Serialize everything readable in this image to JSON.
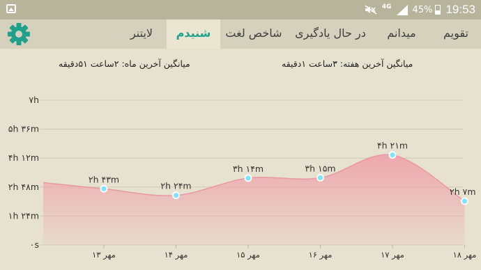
{
  "status_bar": {
    "network": "4G",
    "battery": "45%",
    "battery_level": 0.45,
    "time": "19:53"
  },
  "tabs": [
    {
      "label": "تقویم",
      "active": false
    },
    {
      "label": "میدانم",
      "active": false
    },
    {
      "label": "در حال یادگیری",
      "active": false
    },
    {
      "label": "شاخص لغت",
      "active": false
    },
    {
      "label": "شنیدم",
      "active": true
    },
    {
      "label": "لایتنر",
      "active": false
    }
  ],
  "averages": {
    "week": "میانگین آخرین هفته: ۳ساعت ۱دقیقه",
    "month": "میانگین آخرین ماه: ۲ساعت ۵۱دقیقه"
  },
  "colors": {
    "accent": "#1fa18c",
    "area_fill": "#eea7ae",
    "point": "#7fe3ff"
  },
  "chart_data": {
    "type": "area",
    "y_unit": "minutes",
    "ylim": [
      0,
      420
    ],
    "y_ticks": [
      {
        "value": 0,
        "label": "۰s"
      },
      {
        "value": 84,
        "label": "۱h ۲۴m"
      },
      {
        "value": 168,
        "label": "۲h ۴۸m"
      },
      {
        "value": 252,
        "label": "۴h ۱۲m"
      },
      {
        "value": 336,
        "label": "۵h ۳۶m"
      },
      {
        "value": 420,
        "label": "۷h"
      }
    ],
    "categories": [
      "۱۳ مهر",
      "۱۴ مهر",
      "۱۵ مهر",
      "۱۶ مهر",
      "۱۷ مهر",
      "۱۸ مهر"
    ],
    "values": [
      163,
      144,
      194,
      195,
      261,
      127
    ],
    "data_labels": [
      "۲h ۴۳m",
      "۲h ۲۴m",
      "۳h ۱۴m",
      "۳h ۱۵m",
      "۴h ۲۱m",
      "۲h ۷m"
    ],
    "left_edge_value": 181,
    "grid": true
  }
}
